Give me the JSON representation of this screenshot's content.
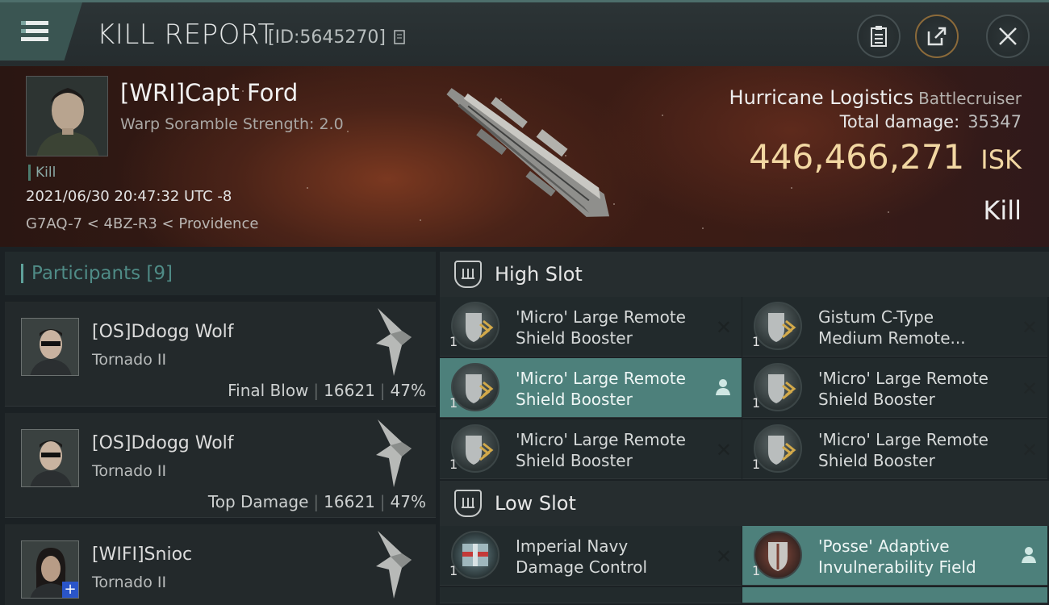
{
  "header": {
    "title": "KILL REPORT",
    "report_id": "[ID:5645270]"
  },
  "victim": {
    "name": "[WRI]Capt Ford",
    "subtitle": "Warp Soramble Strength: 2.0",
    "result_tag": "Kill",
    "timestamp": "2021/06/30 20:47:32 UTC -8",
    "location": "G7AQ-7 < 4BZ-R3 < Providence",
    "ship_name": "Hurricane Logistics",
    "ship_class": "Battlecruiser",
    "total_damage_label": "Total damage:",
    "total_damage": "35347",
    "isk_value": "446,466,271",
    "isk_unit": "ISK",
    "result": "Kill"
  },
  "participants": {
    "label": "Participants",
    "count": "[9]",
    "rows": [
      {
        "name": "[OS]Ddogg Wolf",
        "ship": "Tornado II",
        "tag": "Final Blow",
        "damage": "16621",
        "percent": "47%"
      },
      {
        "name": "[OS]Ddogg Wolf",
        "ship": "Tornado II",
        "tag": "Top Damage",
        "damage": "16621",
        "percent": "47%"
      },
      {
        "name": "[WIFI]Snioc",
        "ship": "Tornado II",
        "tag": "",
        "damage": "",
        "percent": ""
      }
    ]
  },
  "slots": {
    "high": {
      "label": "High Slot",
      "modules": [
        {
          "line1": "'Micro' Large Remote",
          "line2": "Shield Booster",
          "qty": "1",
          "active": false
        },
        {
          "line1": "Gistum C-Type",
          "line2": "Medium Remote...",
          "qty": "1",
          "active": false
        },
        {
          "line1": "'Micro' Large Remote",
          "line2": "Shield Booster",
          "qty": "1",
          "active": true
        },
        {
          "line1": "'Micro' Large Remote",
          "line2": "Shield Booster",
          "qty": "1",
          "active": false
        },
        {
          "line1": "'Micro' Large Remote",
          "line2": "Shield Booster",
          "qty": "1",
          "active": false
        },
        {
          "line1": "'Micro' Large Remote",
          "line2": "Shield Booster",
          "qty": "1",
          "active": false
        }
      ]
    },
    "low": {
      "label": "Low Slot",
      "modules": [
        {
          "line1": "Imperial Navy",
          "line2": "Damage Control",
          "qty": "1",
          "active": false
        },
        {
          "line1": "'Posse' Adaptive",
          "line2": "Invulnerability Field",
          "qty": "1",
          "active": true
        }
      ]
    }
  },
  "icons": {
    "menu": "menu-icon",
    "copy": "copy-icon",
    "clipboard": "clipboard-icon",
    "share": "share-icon",
    "close": "close-icon",
    "slot": "slot-icon",
    "remove": "close-x-icon",
    "person": "person-icon"
  },
  "colors": {
    "accent": "#4d807b",
    "isk": "#f2d7a2",
    "participants_label": "#4f8b86",
    "plus_badge": "#2a55c9"
  }
}
